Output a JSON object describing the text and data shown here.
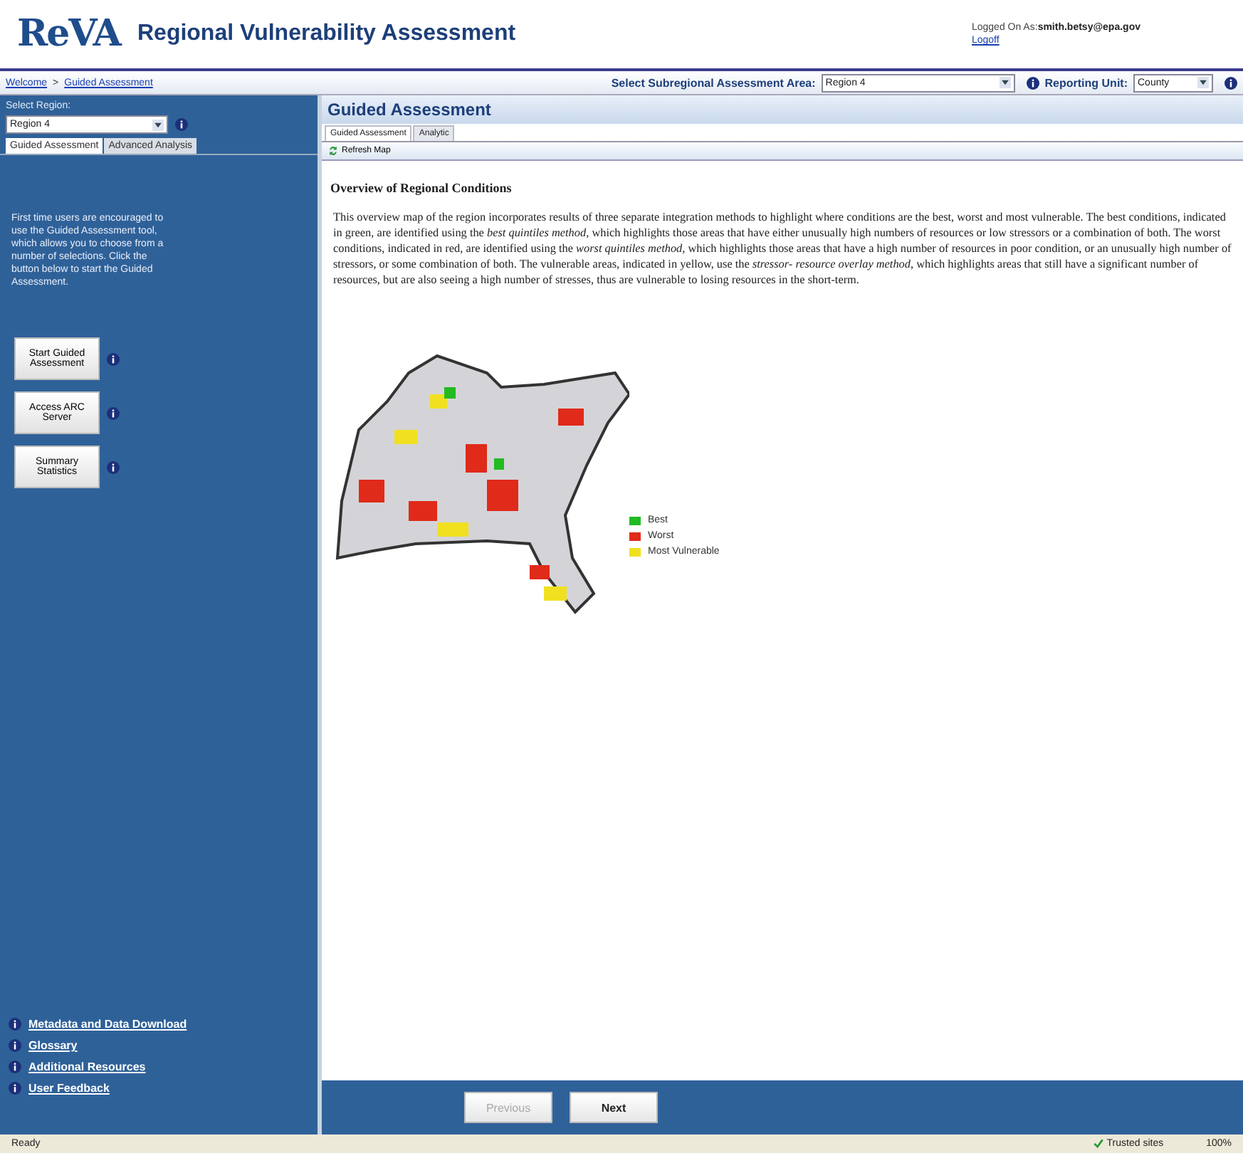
{
  "header": {
    "logo": "ReVA",
    "title": "Regional Vulnerability Assessment",
    "login_label": "Logged On As:",
    "login_user": "smith.betsy@epa.gov",
    "logoff": "Logoff"
  },
  "breadcrumb": [
    {
      "label": "Welcome"
    },
    {
      "label": "Guided Assessment"
    }
  ],
  "breadcrumb_separator": ">",
  "subregion": {
    "label": "Select Subregional Assessment Area:",
    "value": "Region 4"
  },
  "reporting_unit": {
    "label": "Reporting Unit:",
    "value": "County"
  },
  "sidebar": {
    "region_label": "Select Region:",
    "region_value": "Region 4",
    "tabs": [
      {
        "label": "Guided Assessment",
        "selected": true
      },
      {
        "label": "Advanced Analysis",
        "selected": false
      }
    ],
    "intro": "First time users are encouraged to use the Guided Assessment tool, which allows you to choose from a number of selections. Click the button below to start the Guided Assessment.",
    "buttons": [
      {
        "label": "Start Guided Assessment"
      },
      {
        "label": "Access ARC Server"
      },
      {
        "label": "Summary Statistics"
      }
    ],
    "links": [
      {
        "label": "Metadata and Data Download"
      },
      {
        "label": "Glossary"
      },
      {
        "label": "Additional Resources"
      },
      {
        "label": "User Feedback"
      }
    ]
  },
  "panel": {
    "title": "Guided Assessment",
    "tabs": [
      {
        "label": "Guided Assessment",
        "selected": true
      },
      {
        "label": "Analytic",
        "selected": false
      }
    ],
    "toolbar": {
      "refresh": "Refresh Map"
    },
    "heading": "Overview of Regional Conditions",
    "paragraph": "This overview map of the region incorporates results of three separate integration methods to highlight where conditions are the best, worst and most vulnerable.  The best conditions, indicated in green, are identified using the *best quintiles method,* which highlights those areas that have either unusually high numbers of resources or low stressors or a combination of both.  The worst conditions, indicated in red, are identified using the *worst quintiles method,* which highlights those areas that have a high number of resources in poor condition, or an unusually high number of stressors, or some combination of both.  The vulnerable areas, indicated in yellow, use the *stressor- resource overlay method,* which highlights areas that still have a significant number of resources, but are also seeing a high number of stresses, thus are vulnerable to losing resources in the short-term.",
    "legend": [
      {
        "label": "Best",
        "color": "#22bb22"
      },
      {
        "label": "Worst",
        "color": "#e02a1a"
      },
      {
        "label": "Most Vulnerable",
        "color": "#f0e020"
      }
    ],
    "nav": [
      {
        "label": "Previous",
        "disabled": true
      },
      {
        "label": "Next",
        "disabled": false
      }
    ]
  },
  "status_bar": {
    "status": "Ready",
    "zone": "Trusted sites",
    "zoom": "100%"
  }
}
